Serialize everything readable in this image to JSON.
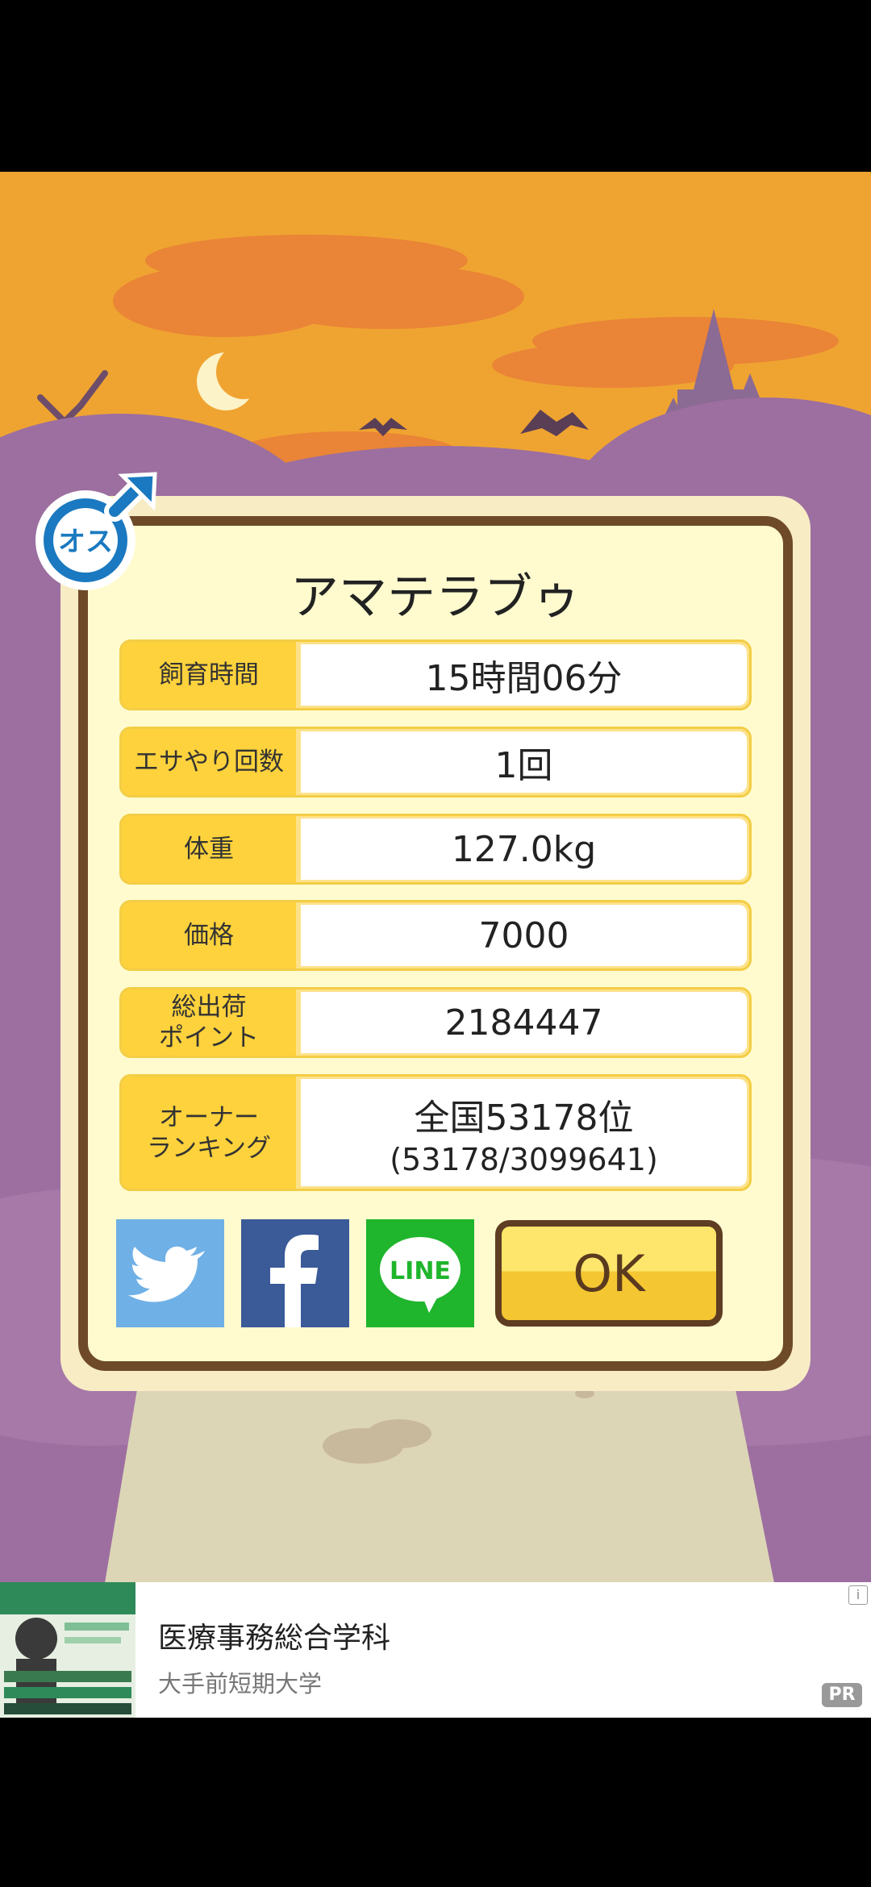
{
  "pet": {
    "name": "アマテラブゥ",
    "gender_badge": "オス"
  },
  "stats": [
    {
      "label": "飼育時間",
      "value": "15時間06分"
    },
    {
      "label": "エサやり回数",
      "value": "1回"
    },
    {
      "label": "体重",
      "value": "127.0kg"
    },
    {
      "label": "価格",
      "value": "7000"
    },
    {
      "label": "総出荷\nポイント",
      "value": "2184447"
    },
    {
      "label": "オーナー\nランキング",
      "value": "全国53178位",
      "value_sub": "(53178/3099641)"
    }
  ],
  "buttons": {
    "ok": "OK",
    "line": "LINE"
  },
  "icons": [
    "male-symbol-icon",
    "twitter-bird-icon",
    "facebook-f-icon",
    "line-logo-icon",
    "crescent-moon-icon",
    "bat-icon",
    "castle-icon"
  ],
  "ad": {
    "title": "医療事務総合学科",
    "subtitle": "大手前短期大学",
    "pr_label": "PR",
    "info_label": "i"
  },
  "colors": {
    "sky": "#efa431",
    "cloud": "#ea8436",
    "hills": "#9c6fa0",
    "panel_border": "#6e4a28",
    "panel_fill": "#fffbcf",
    "label_fill": "#fdd23c",
    "twitter": "#6fb0e6",
    "facebook": "#3a5a98",
    "line": "#1fb52c",
    "ok_button": "#f4c732",
    "gender_badge": "#1a79c0"
  }
}
